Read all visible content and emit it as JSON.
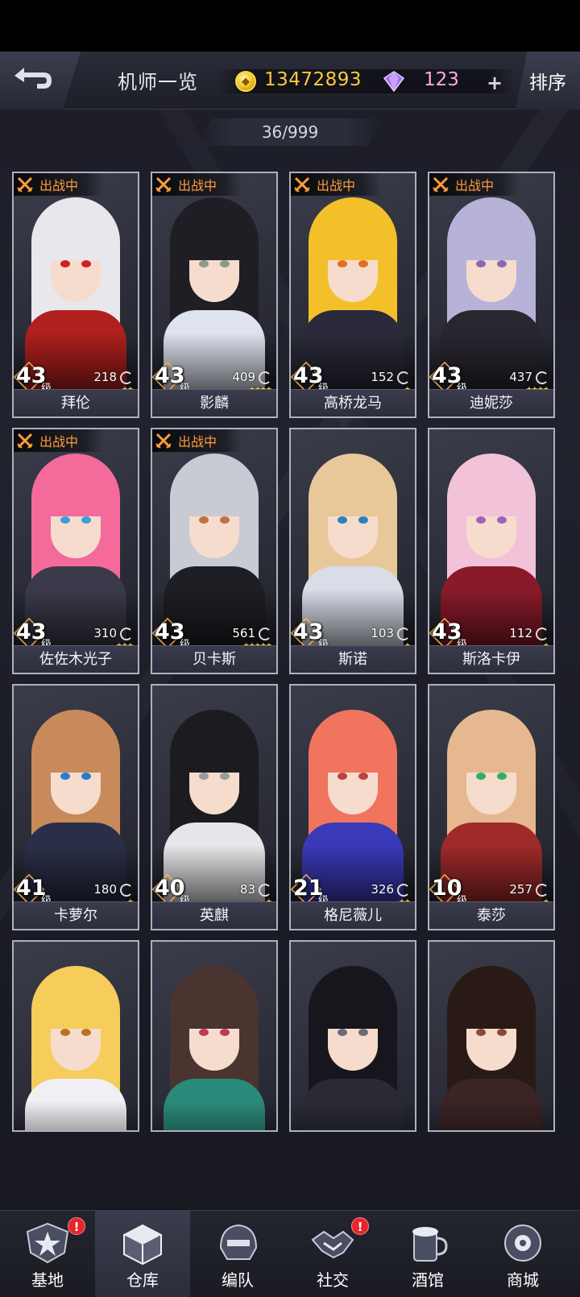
{
  "header": {
    "title": "机师一览",
    "coins": "13472893",
    "gems": "123",
    "plus": "+",
    "sort_label": "排序"
  },
  "counter": "36/999",
  "battle_label": "出战中",
  "level_suffix": "级",
  "pilots": [
    {
      "name": "拜伦",
      "level": "43",
      "power": "218",
      "stars": "★★",
      "in_battle": true,
      "hair": "#e8e8ec",
      "accent": "#b0201e",
      "eye": "#d02020"
    },
    {
      "name": "影麟",
      "level": "43",
      "power": "409",
      "stars": "★★★★",
      "in_battle": true,
      "hair": "#1e1e24",
      "accent": "#dfe2ef",
      "eye": "#8a9a8a"
    },
    {
      "name": "高桥龙马",
      "level": "43",
      "power": "152",
      "stars": "★",
      "in_battle": true,
      "hair": "#f4c02a",
      "accent": "#2a2a3a",
      "eye": "#e07020"
    },
    {
      "name": "迪妮莎",
      "level": "43",
      "power": "437",
      "stars": "★★★★",
      "in_battle": true,
      "hair": "#b7b2d8",
      "accent": "#2a2630",
      "eye": "#8a6ab0"
    },
    {
      "name": "佐佐木光子",
      "level": "43",
      "power": "310",
      "stars": "★★★",
      "in_battle": true,
      "hair": "#f46a9a",
      "accent": "#3a3a4a",
      "eye": "#3aa0d8"
    },
    {
      "name": "贝卡斯",
      "level": "43",
      "power": "561",
      "stars": "★★★★★",
      "in_battle": true,
      "hair": "#c8cad4",
      "accent": "#1e1f24",
      "eye": "#c07040"
    },
    {
      "name": "斯诺",
      "level": "43",
      "power": "103",
      "stars": "★",
      "in_battle": false,
      "hair": "#e8c898",
      "accent": "#d8dde8",
      "eye": "#2a80c0"
    },
    {
      "name": "斯洛卡伊",
      "level": "43",
      "power": "112",
      "stars": "★",
      "in_battle": false,
      "hair": "#f2c2d8",
      "accent": "#8a1a2a",
      "eye": "#a060c0"
    },
    {
      "name": "卡萝尔",
      "level": "41",
      "power": "180",
      "stars": "★",
      "in_battle": false,
      "hair": "#c88a5a",
      "accent": "#2a2e48",
      "eye": "#2a7ad0"
    },
    {
      "name": "英麒",
      "level": "40",
      "power": "83",
      "stars": "★",
      "in_battle": false,
      "hair": "#1c1c20",
      "accent": "#e6e6ea",
      "eye": "#9a9a9a"
    },
    {
      "name": "格尼薇儿",
      "level": "21",
      "power": "326",
      "stars": "★★",
      "in_battle": false,
      "hair": "#f0745e",
      "accent": "#3a3ab8",
      "eye": "#c04040"
    },
    {
      "name": "泰莎",
      "level": "10",
      "power": "257",
      "stars": "★",
      "in_battle": false,
      "hair": "#e6b890",
      "accent": "#a02a2a",
      "eye": "#30b060"
    },
    {
      "name": "",
      "level": "",
      "power": "",
      "stars": "",
      "in_battle": false,
      "hair": "#f6cc5a",
      "accent": "#f0f0f4",
      "eye": "#c07020"
    },
    {
      "name": "",
      "level": "",
      "power": "",
      "stars": "",
      "in_battle": false,
      "hair": "#4a3430",
      "accent": "#2a8a7a",
      "eye": "#c03a5a"
    },
    {
      "name": "",
      "level": "",
      "power": "",
      "stars": "",
      "in_battle": false,
      "hair": "#16161c",
      "accent": "#2a2a34",
      "eye": "#6a6a7a"
    },
    {
      "name": "",
      "level": "",
      "power": "",
      "stars": "",
      "in_battle": false,
      "hair": "#2a1a16",
      "accent": "#3a2424",
      "eye": "#8a4a3a"
    }
  ],
  "nav": [
    {
      "label": "基地",
      "icon": "base-emblem-icon",
      "badge": "!"
    },
    {
      "label": "仓库",
      "icon": "warehouse-cube-icon",
      "badge": "",
      "active": true
    },
    {
      "label": "编队",
      "icon": "formation-helmet-icon",
      "badge": ""
    },
    {
      "label": "社交",
      "icon": "handshake-icon",
      "badge": "!"
    },
    {
      "label": "酒馆",
      "icon": "tavern-mug-icon",
      "badge": ""
    },
    {
      "label": "商城",
      "icon": "shop-robot-icon",
      "badge": ""
    }
  ],
  "colors": {
    "coin": "#ffc93a",
    "gem": "#ffa9e4",
    "battle": "#ff9d3a",
    "badge": "#e5262b"
  }
}
